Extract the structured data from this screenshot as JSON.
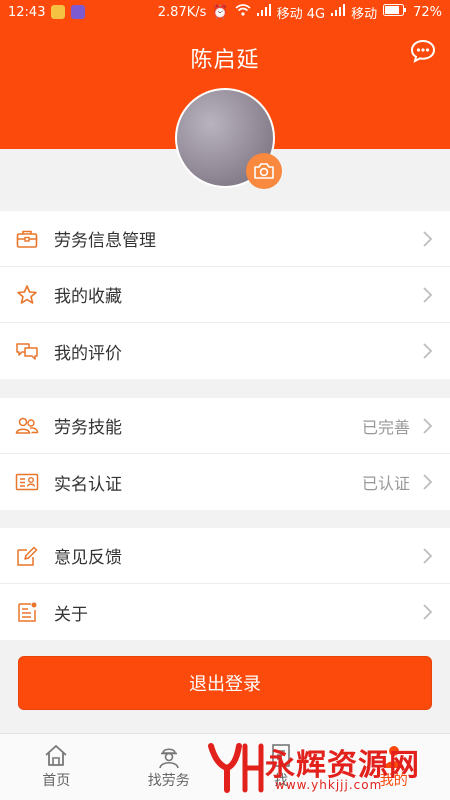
{
  "status_bar": {
    "time": "12:43",
    "speed": "2.87K/s",
    "carrier1": "移动 4G",
    "carrier2": "移动",
    "battery": "72%"
  },
  "header": {
    "title": "陈启延",
    "message_icon": "chat-bubble-icon",
    "camera_icon": "camera-icon"
  },
  "menu": {
    "group1": [
      {
        "label": "劳务信息管理",
        "icon": "briefcase-icon"
      },
      {
        "label": "我的收藏",
        "icon": "star-icon"
      },
      {
        "label": "我的评价",
        "icon": "comments-icon"
      }
    ],
    "group2": [
      {
        "label": "劳务技能",
        "status": "已完善",
        "icon": "people-icon"
      },
      {
        "label": "实名认证",
        "status": "已认证",
        "icon": "id-card-icon"
      }
    ],
    "group3": [
      {
        "label": "意见反馈",
        "icon": "edit-icon"
      },
      {
        "label": "关于",
        "icon": "info-doc-icon"
      }
    ]
  },
  "logout_label": "退出登录",
  "tabs": [
    {
      "label": "首页",
      "icon": "home-icon"
    },
    {
      "label": "找劳务",
      "icon": "worker-icon"
    },
    {
      "label": "找",
      "icon": "doc-icon"
    },
    {
      "label": "我的",
      "icon": "profile-icon"
    }
  ],
  "watermark": {
    "brand": "永辉资源网",
    "url": "www.yhkjjj.com"
  },
  "colors": {
    "accent": "#fb4a0b",
    "camera": "#f8893e",
    "watermark": "#e2211c"
  }
}
